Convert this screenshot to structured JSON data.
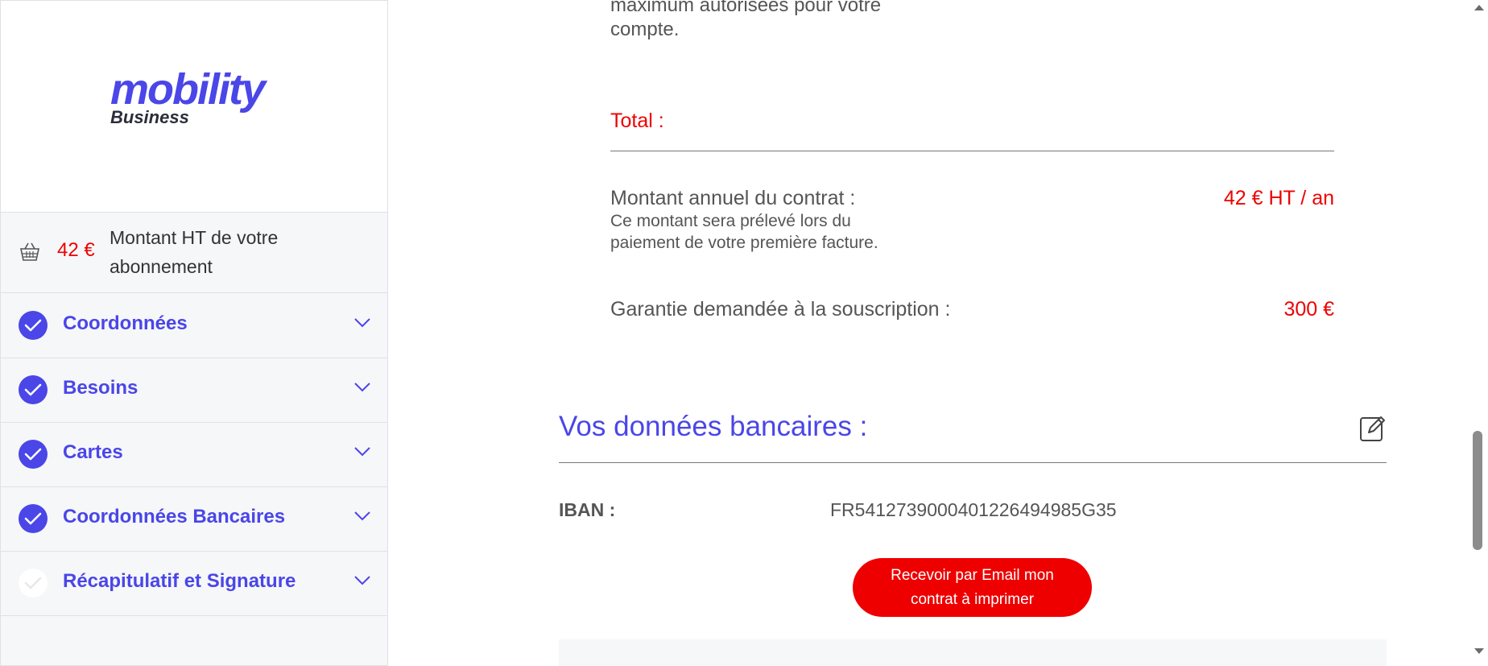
{
  "sidebar": {
    "logo_main": "mobility",
    "logo_sub": "Business",
    "price_amount": "42 €",
    "price_label": "Montant HT de votre abonnement",
    "steps": [
      {
        "label": "Coordonnées",
        "done": true
      },
      {
        "label": "Besoins",
        "done": true
      },
      {
        "label": "Cartes",
        "done": true
      },
      {
        "label": "Coordonnées Bancaires",
        "done": true
      },
      {
        "label": "Récapitulatif et Signature",
        "done": false
      }
    ]
  },
  "main": {
    "top_text_line1": "maximum autorisées pour votre",
    "top_text_line2": "compte.",
    "total_label": "Total :",
    "annual_label": "Montant annuel du contrat :",
    "annual_value": "42 € HT / an",
    "annual_note_line1": "Ce montant sera prélevé lors du",
    "annual_note_line2": "paiement de votre première facture.",
    "guarantee_label": "Garantie demandée à la souscription :",
    "guarantee_value": "300 €",
    "bank_title": "Vos données bancaires :",
    "iban_label": "IBAN :",
    "iban_value": "FR5412739000401226494985G35",
    "email_button_line1": "Recevoir par Email mon",
    "email_button_line2": "contrat à imprimer"
  },
  "colors": {
    "brand": "#4a46e8",
    "accent_red": "#ee0000"
  }
}
